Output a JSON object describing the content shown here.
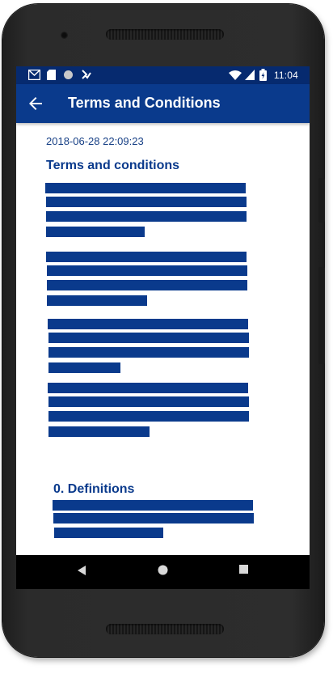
{
  "status_bar": {
    "time": "11:04",
    "left_icons": [
      "gmail-icon",
      "sim-card-icon",
      "circle-notification-icon",
      "download-check-icon"
    ],
    "right_icons": [
      "wifi-icon",
      "cell-signal-icon",
      "battery-charging-icon"
    ]
  },
  "app_bar": {
    "title": "Terms and Conditions",
    "back_icon": "arrow-back-icon"
  },
  "document": {
    "timestamp": "2018-06-28 22:09:23",
    "heading": "Terms and conditions",
    "paragraph_count": 4,
    "section_heading": "0. Definitions"
  },
  "nav_bar": {
    "buttons": [
      "back-triangle-icon",
      "home-circle-icon",
      "recents-square-icon"
    ]
  },
  "colors": {
    "primary": "#0a3a8c",
    "status_bar": "#062a6f",
    "text_accent": "#163f85",
    "nav_bar": "#000000"
  }
}
